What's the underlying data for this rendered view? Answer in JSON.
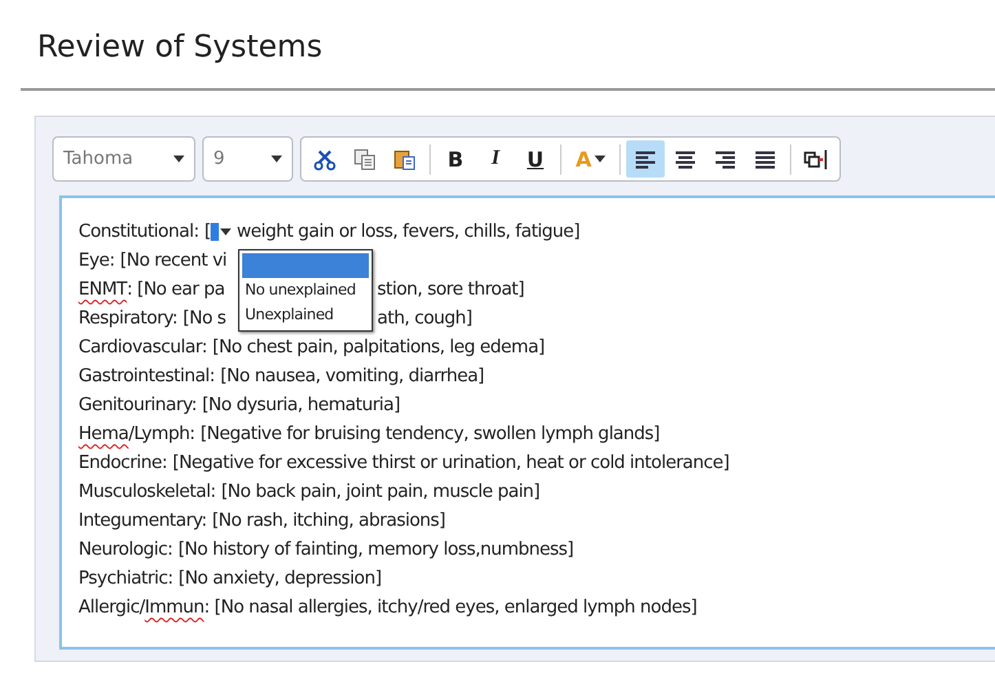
{
  "title": "Review of Systems",
  "toolbar": {
    "font": "Tahoma",
    "size": "9",
    "clipboard": [
      {
        "kind": "cut"
      },
      {
        "kind": "copy"
      },
      {
        "kind": "paste"
      }
    ],
    "format": [
      {
        "kind": "bold",
        "text": "B"
      },
      {
        "kind": "italic",
        "text": "I"
      },
      {
        "kind": "underline",
        "text": "U"
      }
    ],
    "color": {
      "text": "A"
    },
    "align": [
      {
        "kind": "left",
        "selected": true
      },
      {
        "kind": "center",
        "selected": false
      },
      {
        "kind": "right",
        "selected": false
      },
      {
        "kind": "justify",
        "selected": false
      }
    ],
    "extra": [
      {
        "kind": "field"
      }
    ]
  },
  "dropdown": {
    "options": [
      {
        "selected": true
      },
      {
        "text": "No unexplained",
        "selected": false
      },
      {
        "text": "Unexplained",
        "selected": false
      }
    ]
  },
  "lines": [
    {
      "kind": "field",
      "label": [
        {
          "text": "Constitutional:",
          "misspelled": false
        }
      ],
      "text": "[",
      "text_after": "weight gain or loss, fevers, chills, fatigue]"
    },
    {
      "kind": "covered",
      "label": [
        {
          "text": "Eye:",
          "misspelled": false
        }
      ],
      "text": "[No recent vi"
    },
    {
      "kind": "covered",
      "label": [
        {
          "text": "ENMT",
          "misspelled": true
        }
      ],
      "text": ": [No ear pa",
      "text_after": "stion, sore throat]"
    },
    {
      "kind": "covered",
      "label": [
        {
          "text": "Respiratory:",
          "misspelled": false
        }
      ],
      "text": "[No s",
      "text_after": "ath, cough]"
    },
    {
      "kind": "plain",
      "label": [
        {
          "text": "Cardiovascular:",
          "misspelled": false
        }
      ],
      "text": "[No chest pain, palpitations, leg edema]"
    },
    {
      "kind": "plain",
      "label": [
        {
          "text": "Gastrointestinal:",
          "misspelled": false
        }
      ],
      "text": "[No nausea, vomiting, diarrhea]"
    },
    {
      "kind": "plain",
      "label": [
        {
          "text": "Genitourinary:",
          "misspelled": false
        }
      ],
      "text": "[No dysuria, hematuria]"
    },
    {
      "kind": "plain",
      "label": [
        {
          "text": "Hema",
          "misspelled": true
        },
        {
          "text": "/Lymph:",
          "misspelled": false
        }
      ],
      "text": "[Negative for bruising tendency, swollen lymph glands]"
    },
    {
      "kind": "plain",
      "label": [
        {
          "text": "Endocrine:",
          "misspelled": false
        }
      ],
      "text": "[Negative for excessive thirst or urination, heat or cold intolerance]"
    },
    {
      "kind": "plain",
      "label": [
        {
          "text": "Musculoskeletal:",
          "misspelled": false
        }
      ],
      "text": "[No back pain, joint pain, muscle pain]"
    },
    {
      "kind": "plain",
      "label": [
        {
          "text": "Integumentary:",
          "misspelled": false
        }
      ],
      "text": "[No rash, itching, abrasions]"
    },
    {
      "kind": "plain",
      "label": [
        {
          "text": "Neurologic:",
          "misspelled": false
        }
      ],
      "text": "[No history of fainting, memory loss,numbness]"
    },
    {
      "kind": "plain",
      "label": [
        {
          "text": "Psychiatric:",
          "misspelled": false
        }
      ],
      "text": "[No anxiety, depression]"
    },
    {
      "kind": "plain",
      "label": [
        {
          "text": "Allergic/",
          "misspelled": false
        },
        {
          "text": "Immun",
          "misspelled": true
        }
      ],
      "text": ": [No nasal allergies, itchy/red eyes, enlarged lymph nodes]"
    }
  ]
}
